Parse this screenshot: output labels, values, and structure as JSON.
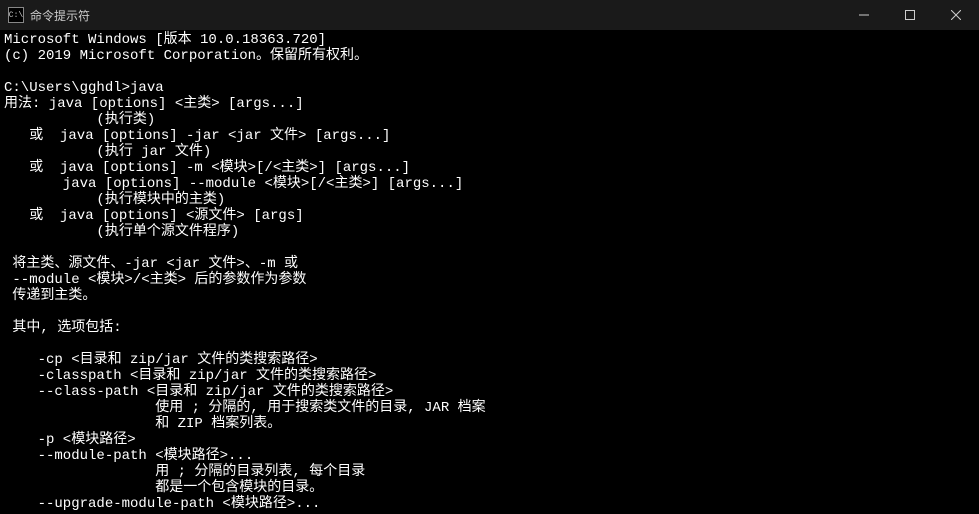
{
  "titlebar": {
    "icon_label": "C:\\",
    "title": "命令提示符"
  },
  "terminal": {
    "lines": [
      "Microsoft Windows [版本 10.0.18363.720]",
      "(c) 2019 Microsoft Corporation。保留所有权利。",
      "",
      "C:\\Users\\gghdl>java",
      "用法: java [options] <主类> [args...]",
      "           (执行类)",
      "   或  java [options] -jar <jar 文件> [args...]",
      "           (执行 jar 文件)",
      "   或  java [options] -m <模块>[/<主类>] [args...]",
      "       java [options] --module <模块>[/<主类>] [args...]",
      "           (执行模块中的主类)",
      "   或  java [options] <源文件> [args]",
      "           (执行单个源文件程序)",
      "",
      " 将主类、源文件、-jar <jar 文件>、-m 或",
      " --module <模块>/<主类> 后的参数作为参数",
      " 传递到主类。",
      "",
      " 其中, 选项包括:",
      "",
      "    -cp <目录和 zip/jar 文件的类搜索路径>",
      "    -classpath <目录和 zip/jar 文件的类搜索路径>",
      "    --class-path <目录和 zip/jar 文件的类搜索路径>",
      "                  使用 ; 分隔的, 用于搜索类文件的目录, JAR 档案",
      "                  和 ZIP 档案列表。",
      "    -p <模块路径>",
      "    --module-path <模块路径>...",
      "                  用 ; 分隔的目录列表, 每个目录",
      "                  都是一个包含模块的目录。",
      "    --upgrade-module-path <模块路径>..."
    ]
  }
}
